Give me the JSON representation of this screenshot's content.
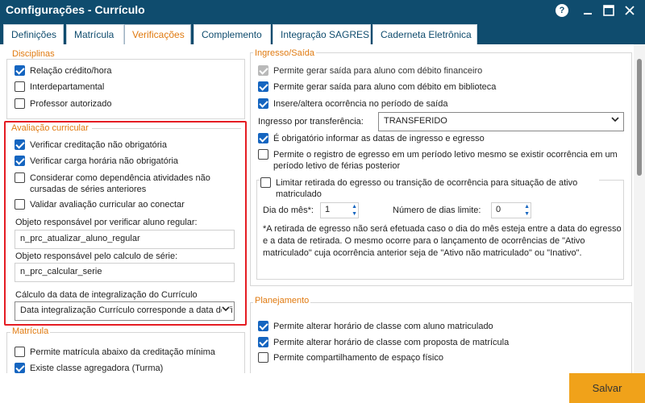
{
  "window": {
    "title": "Configurações - Currículo"
  },
  "tabs": [
    {
      "label": "Definições"
    },
    {
      "label": "Matrícula"
    },
    {
      "label": "Verificações"
    },
    {
      "label": "Complemento"
    },
    {
      "label": "Integração SAGRES"
    },
    {
      "label": "Caderneta Eletrônica"
    }
  ],
  "disciplinas": {
    "title": "Disciplinas",
    "items": [
      {
        "label": "Relação crédito/hora",
        "checked": true
      },
      {
        "label": "Interdepartamental",
        "checked": false
      },
      {
        "label": "Professor autorizado",
        "checked": false
      }
    ]
  },
  "avaliacao": {
    "title": "Avaliação curricular",
    "items": [
      {
        "label": "Verificar creditação não obrigatória",
        "checked": true
      },
      {
        "label": "Verificar carga horária não obrigatória",
        "checked": true
      },
      {
        "label": "Considerar como dependência atividades não cursadas de séries anteriores",
        "checked": false
      },
      {
        "label": "Validar avaliação curricular ao conectar",
        "checked": false
      }
    ],
    "obj_regular_label": "Objeto responsável por verificar aluno regular:",
    "obj_regular_value": "n_prc_atualizar_aluno_regular",
    "obj_serie_label": "Objeto responsável pelo calculo de série:",
    "obj_serie_value": "n_prc_calcular_serie",
    "calc_label": "Cálculo da data de integralização do Currículo",
    "calc_value": "Data integralização Currículo corresponde a data do fi"
  },
  "matricula": {
    "title": "Matrícula",
    "items": [
      {
        "label": "Permite matrícula abaixo da creditação mínima",
        "checked": false
      },
      {
        "label": "Existe classe agregadora (Turma)",
        "checked": true
      }
    ]
  },
  "ingresso": {
    "title": "Ingresso/Saída",
    "items": [
      {
        "label": "Permite gerar saída para aluno com débito financeiro",
        "checked": true,
        "disabled": true
      },
      {
        "label": "Permite gerar saída para aluno com débito em biblioteca",
        "checked": true
      },
      {
        "label": "Insere/altera ocorrência no período de saída",
        "checked": true
      }
    ],
    "transfer_label": "Ingresso por transferência:",
    "transfer_value": "TRANSFERIDO",
    "items2": [
      {
        "label": "É obrigatório informar as datas de ingresso e egresso",
        "checked": true
      },
      {
        "label": "Permite o registro de egresso em um período letivo mesmo se existir ocorrência em um período letivo de férias posterior",
        "checked": false
      }
    ],
    "limitar": {
      "label": "Limitar retirada do egresso ou transição de ocorrência para situação de ativo matriculado",
      "checked": false,
      "dia_label": "Dia do mês*:",
      "dia_value": "1",
      "dias_label": "Número de dias limite:",
      "dias_value": "0",
      "note": "*A retirada de egresso não será efetuada caso o dia do mês esteja entre a data do egresso e a data de retirada. O mesmo ocorre para o lançamento de ocorrências de \"Ativo matriculado\" cuja ocorrência anterior seja de \"Ativo não matriculado\" ou \"Inativo\"."
    }
  },
  "planejamento": {
    "title": "Planejamento",
    "items": [
      {
        "label": "Permite alterar horário de classe com aluno matriculado",
        "checked": true
      },
      {
        "label": "Permite alterar horário de classe com proposta de matrícula",
        "checked": true
      },
      {
        "label": "Permite compartilhamento de espaço físico",
        "checked": false
      }
    ]
  },
  "footer": {
    "save_label": "Salvar"
  },
  "colors": {
    "titlebar": "#0f4c6e",
    "accent": "#e07a10",
    "checkbox": "#1565c0",
    "highlight": "#e51c23",
    "save": "#f0a21a"
  }
}
